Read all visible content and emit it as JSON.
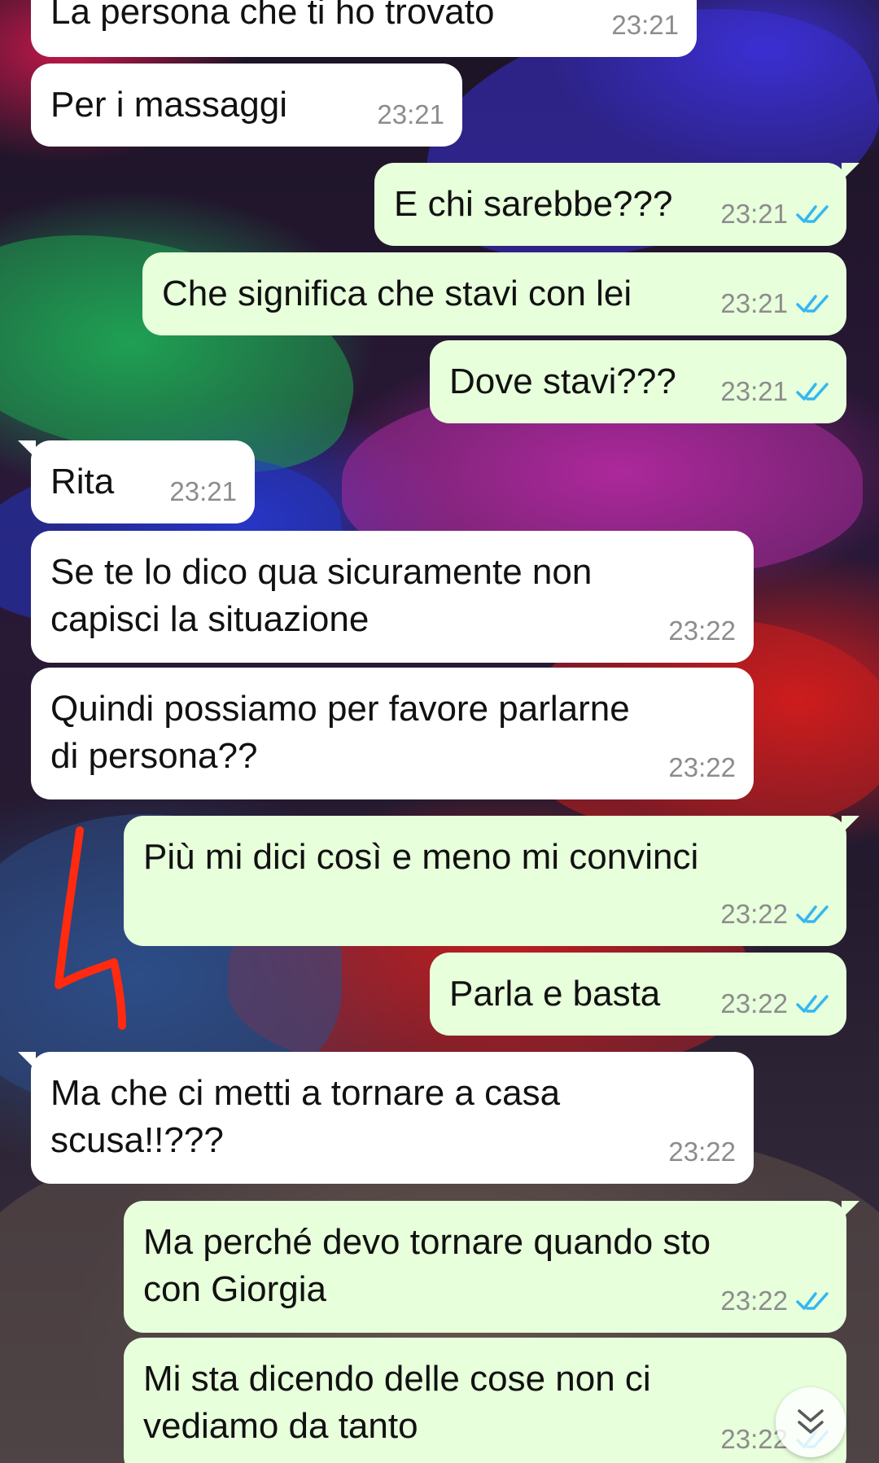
{
  "colors": {
    "incoming_bubble": "#ffffff",
    "outgoing_bubble": "#e7ffdb",
    "timestamp": "#8c8c8c",
    "read_ticks": "#34b7f1",
    "annotation": "#ff2a10"
  },
  "messages": [
    {
      "direction": "in",
      "text": "La persona che ti ho trovato",
      "time": "23:21"
    },
    {
      "direction": "in",
      "text": "Per i massaggi",
      "time": "23:21"
    },
    {
      "direction": "out",
      "text": "E chi sarebbe???",
      "time": "23:21",
      "status": "read-double-check-icon"
    },
    {
      "direction": "out",
      "text": "Che significa che stavi con lei",
      "time": "23:21",
      "status": "read-double-check-icon"
    },
    {
      "direction": "out",
      "text": "Dove stavi???",
      "time": "23:21",
      "status": "read-double-check-icon"
    },
    {
      "direction": "in",
      "text": "Rita",
      "time": "23:21"
    },
    {
      "direction": "in",
      "text": "Se te lo dico qua sicuramente non\ncapisci la situazione",
      "time": "23:22"
    },
    {
      "direction": "in",
      "text": "Quindi possiamo per favore parlarne\ndi persona??",
      "time": "23:22"
    },
    {
      "direction": "out",
      "text": "Più mi dici così e meno mi convinci",
      "time": "23:22",
      "status": "read-double-check-icon"
    },
    {
      "direction": "out",
      "text": "Parla e basta",
      "time": "23:22",
      "status": "read-double-check-icon"
    },
    {
      "direction": "in",
      "text": "Ma che ci metti a tornare a casa\nscusa!!???",
      "time": "23:22"
    },
    {
      "direction": "out",
      "text": "Ma perché devo tornare quando sto\ncon Giorgia",
      "time": "23:22",
      "status": "read-double-check-icon"
    },
    {
      "direction": "out",
      "text": "Mi sta dicendo delle cose non ci\nvediamo da tanto",
      "time": "23:22",
      "status": "read-double-check-icon"
    }
  ],
  "icons": {
    "scroll_down": "double-chevron-down-icon",
    "annotation": "red-hand-drawn-arrow"
  }
}
